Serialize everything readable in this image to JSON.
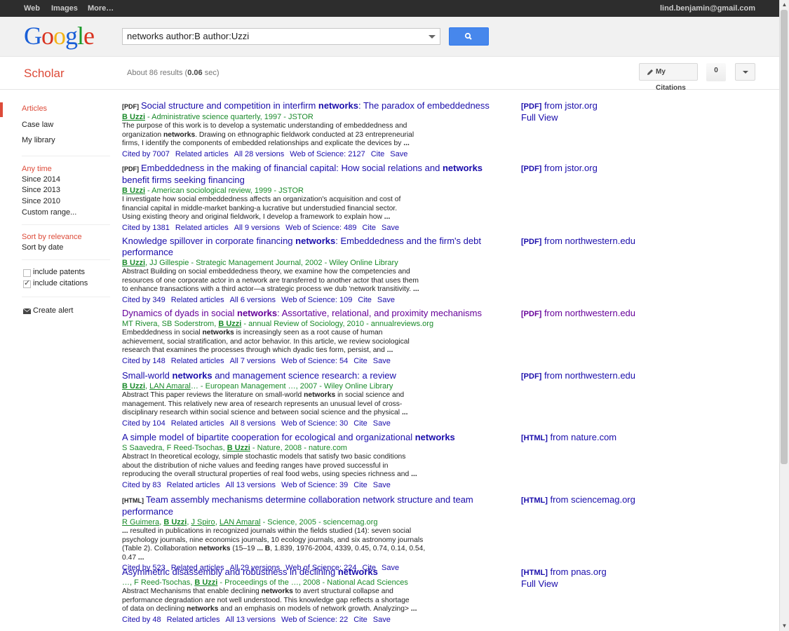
{
  "topbar": {
    "nav": [
      "Web",
      "Images",
      "More…"
    ],
    "user": "lind.benjamin@gmail.com"
  },
  "search": {
    "value": "networks author:B author:Uzzi"
  },
  "logo": {
    "text": [
      "G",
      "o",
      "o",
      "g",
      "l",
      "e"
    ]
  },
  "scholar": {
    "title": "Scholar",
    "count_prefix": "About 86 results (",
    "time": "0.06",
    "count_suffix": " sec)",
    "my_citations": "My Citations",
    "alerts_count": "0"
  },
  "sidebar": {
    "types": [
      "Articles",
      "Case law",
      "My library"
    ],
    "time": [
      "Any time",
      "Since 2014",
      "Since 2013",
      "Since 2010",
      "Custom range..."
    ],
    "sort": [
      "Sort by relevance",
      "Sort by date"
    ],
    "include": [
      "include patents",
      "include citations"
    ],
    "create_alert": "Create alert"
  },
  "results": [
    {
      "tag": "[PDF]",
      "title_parts": [
        "Social structure and competition in interfirm ",
        "networks",
        ": The paradox of embeddedness"
      ],
      "authors": [
        {
          "t": "B Uzzi",
          "style": "bold-link"
        },
        {
          "t": " - Administrative science quarterly, 1997 - JSTOR",
          "style": "plain"
        }
      ],
      "snippet": [
        [
          "The purpose of this work is to develop a systematic understanding of embeddedness and"
        ],
        [
          "organization ",
          "networks",
          ". Drawing on ethnographic fieldwork conducted at 23 entrepreneurial"
        ],
        [
          "firms, I identify the components of embedded relationships and explicate the devices by ",
          "..."
        ]
      ],
      "links": [
        "Cited by 7007",
        "Related articles",
        "All 28 versions",
        "Web of Science: 2127",
        "Cite",
        "Save"
      ],
      "side_tag": "[PDF]",
      "side_text": " from jstor.org",
      "side_extra": "Full View"
    },
    {
      "tag": "[PDF]",
      "title_parts": [
        "Embeddedness in the making of financial capital: How social relations and ",
        "networks",
        " benefit firms seeking financing"
      ],
      "authors": [
        {
          "t": "B Uzzi",
          "style": "bold-link"
        },
        {
          "t": " - American sociological review, 1999 - JSTOR",
          "style": "plain"
        }
      ],
      "snippet": [
        [
          "I investigate how social embeddedness affects an organization's acquisition and cost of"
        ],
        [
          "financial capital in middle-market banking-a lucrative but understudied financial sector."
        ],
        [
          "Using existing theory and original fieldwork, I develop a framework to explain how ",
          "..."
        ]
      ],
      "links": [
        "Cited by 1381",
        "Related articles",
        "All 9 versions",
        "Web of Science: 489",
        "Cite",
        "Save"
      ],
      "side_tag": "[PDF]",
      "side_text": " from jstor.org",
      "side_extra": ""
    },
    {
      "tag": "",
      "title_parts": [
        "Knowledge spillover in corporate financing ",
        "networks",
        ": Embeddedness and the firm's debt performance"
      ],
      "authors": [
        {
          "t": "B Uzzi",
          "style": "bold-link"
        },
        {
          "t": ", JJ Gillespie - Strategic Management Journal, 2002 - Wiley Online Library",
          "style": "plain"
        }
      ],
      "snippet": [
        [
          "Abstract Building on social embeddedness theory, we examine how the competencies and"
        ],
        [
          "resources of one corporate actor in a network are transferred to another actor that uses them"
        ],
        [
          "to enhance transactions with a third actor—a strategic process we dub 'network transitivity. ",
          "..."
        ]
      ],
      "links": [
        "Cited by 349",
        "Related articles",
        "All 6 versions",
        "Web of Science: 109",
        "Cite",
        "Save"
      ],
      "side_tag": "[PDF]",
      "side_text": " from northwestern.edu",
      "side_extra": ""
    },
    {
      "tag": "",
      "title_parts": [
        "Dynamics of dyads in social ",
        "networks",
        ": Assortative, relational, and proximity mechanisms"
      ],
      "authors": [
        {
          "t": "MT Rivera, SB Soderstrom, ",
          "style": "plain"
        },
        {
          "t": "B Uzzi",
          "style": "bold-link"
        },
        {
          "t": " - annual Review of Sociology, 2010 - annualreviews.org",
          "style": "plain"
        }
      ],
      "snippet": [
        [
          "Embeddedness in social ",
          "networks",
          " is increasingly seen as a root cause of human"
        ],
        [
          "achievement, social stratification, and actor behavior. In this article, we review sociological"
        ],
        [
          "research that examines the processes through which dyadic ties form, persist, and ",
          "..."
        ]
      ],
      "links": [
        "Cited by 148",
        "Related articles",
        "All 7 versions",
        "Web of Science: 54",
        "Cite",
        "Save"
      ],
      "side_tag": "[PDF]",
      "side_text": " from northwestern.edu",
      "side_extra": ""
    },
    {
      "tag": "",
      "title_parts": [
        "Small-world ",
        "networks",
        " and management science research: a review"
      ],
      "authors": [
        {
          "t": "B Uzzi",
          "style": "bold-link"
        },
        {
          "t": ", ",
          "style": "plain"
        },
        {
          "t": "LAN Amaral",
          "style": "link"
        },
        {
          "t": "… - European Management …, 2007 - Wiley Online Library",
          "style": "plain"
        }
      ],
      "snippet": [
        [
          "Abstract This paper reviews the literature on small-world ",
          "networks",
          " in social science and"
        ],
        [
          "management. This relatively new area of research represents an unusual level of cross-"
        ],
        [
          "disciplinary research within social science and between social science and the physical ",
          "..."
        ]
      ],
      "links": [
        "Cited by 104",
        "Related articles",
        "All 8 versions",
        "Web of Science: 30",
        "Cite",
        "Save"
      ],
      "side_tag": "[PDF]",
      "side_text": " from northwestern.edu",
      "side_extra": ""
    },
    {
      "tag": "",
      "title_parts": [
        "A simple model of bipartite cooperation for ecological and organizational ",
        "networks",
        ""
      ],
      "authors": [
        {
          "t": "S Saavedra, F Reed-Tsochas, ",
          "style": "plain"
        },
        {
          "t": "B Uzzi",
          "style": "bold-link"
        },
        {
          "t": " - Nature, 2008 - nature.com",
          "style": "plain"
        }
      ],
      "snippet": [
        [
          "Abstract In theoretical ecology, simple stochastic models that satisfy two basic conditions"
        ],
        [
          "about the distribution of niche values and feeding ranges have proved successful in"
        ],
        [
          "reproducing the overall structural properties of real food webs, using species richness and ",
          "..."
        ]
      ],
      "links": [
        "Cited by 83",
        "Related articles",
        "All 13 versions",
        "Web of Science: 39",
        "Cite",
        "Save"
      ],
      "side_tag": "[HTML]",
      "side_text": " from nature.com",
      "side_extra": ""
    },
    {
      "tag": "[HTML]",
      "title_parts": [
        "Team assembly mechanisms determine collaboration network structure and team performance",
        "",
        ""
      ],
      "authors": [
        {
          "t": "R Guimera",
          "style": "link"
        },
        {
          "t": ", ",
          "style": "plain"
        },
        {
          "t": "B Uzzi",
          "style": "bold-link"
        },
        {
          "t": ", ",
          "style": "plain"
        },
        {
          "t": "J Spiro",
          "style": "link"
        },
        {
          "t": ", ",
          "style": "plain"
        },
        {
          "t": "LAN Amaral",
          "style": "link"
        },
        {
          "t": " - Science, 2005 - sciencemag.org",
          "style": "plain"
        }
      ],
      "snippet": [
        [
          "...",
          " resulted in publications in recognized journals within the fields studied (14): seven social"
        ],
        [
          "psychology journals, nine economics journals, 10 ecology journals, and six astronomy journals"
        ],
        [
          "(Table 2). Collaboration ",
          "networks",
          " (15–19 ",
          "... B",
          ", 1.839, 1976-2004, 4339, 0.45, 0.74, 0.14, 0.54, 0.47 ",
          "..."
        ]
      ],
      "links": [
        "Cited by 523",
        "Related articles",
        "All 29 versions",
        "Web of Science: 224",
        "Cite",
        "Save"
      ],
      "side_tag": "[HTML]",
      "side_text": " from sciencemag.org",
      "side_extra": ""
    },
    {
      "tag": "",
      "title_parts": [
        "Asymmetric disassembly and robustness in declining ",
        "networks",
        ""
      ],
      "authors": [
        {
          "t": "…, F Reed-Tsochas, ",
          "style": "plain"
        },
        {
          "t": "B Uzzi",
          "style": "bold-link"
        },
        {
          "t": " - Proceedings of the …, 2008 - National Acad Sciences",
          "style": "plain"
        }
      ],
      "snippet": [
        [
          "Abstract Mechanisms that enable declining ",
          "networks",
          " to avert structural collapse and"
        ],
        [
          "performance degradation are not well understood. This knowledge gap reflects a shortage"
        ],
        [
          "of data on declining ",
          "networks",
          " and an emphasis on models of network growth. Analyzing> ",
          "..."
        ]
      ],
      "links": [
        "Cited by 48",
        "Related articles",
        "All 13 versions",
        "Web of Science: 22",
        "Cite",
        "Save"
      ],
      "side_tag": "[HTML]",
      "side_text": " from pnas.org",
      "side_extra": "Full View"
    }
  ]
}
